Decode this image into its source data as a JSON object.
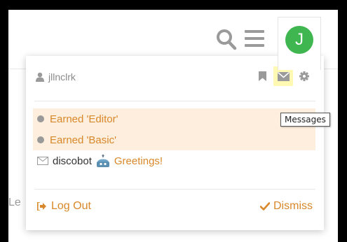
{
  "header": {
    "search_icon": "search-icon",
    "menu_icon": "hamburger-menu-icon",
    "avatar_letter": "J",
    "avatar_color": "#3fb650"
  },
  "background_text": "Le",
  "user_menu": {
    "username": "jllnclrk",
    "icons": [
      "bookmark-icon",
      "envelope-icon",
      "gear-icon"
    ],
    "notifications": [
      {
        "type": "badge",
        "text": "Earned 'Editor'",
        "unread": true
      },
      {
        "type": "badge",
        "text": "Earned 'Basic'",
        "unread": true
      }
    ],
    "pm": {
      "sender": "discobot",
      "text": "Greetings!"
    },
    "logout_label": "Log Out",
    "dismiss_label": "Dismiss",
    "accent_color": "#d8882a"
  },
  "tooltip": "Messages"
}
